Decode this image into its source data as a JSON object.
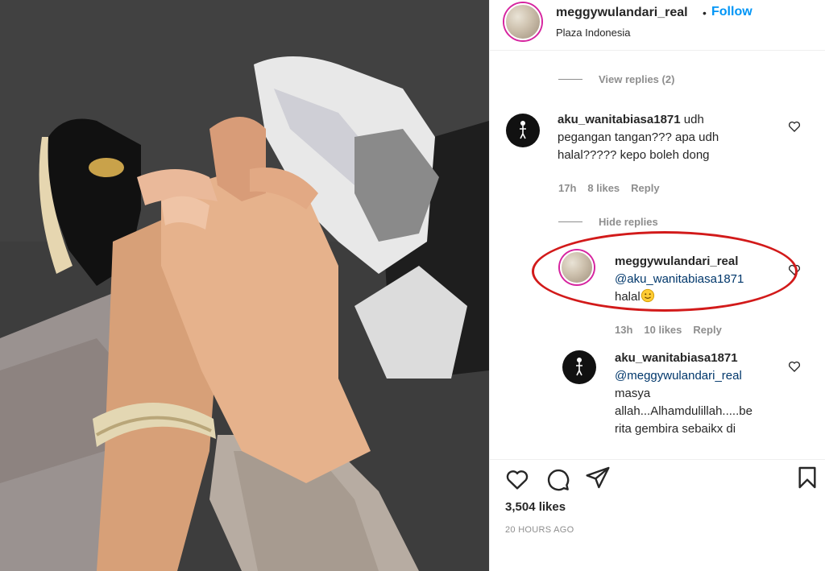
{
  "post": {
    "username": "meggywulandari_real",
    "follow_label": "Follow",
    "location": "Plaza Indonesia",
    "likes": "3,504 likes",
    "time_ago": "20 HOURS AGO"
  },
  "thread": {
    "view_replies": "View replies (2)",
    "hide_replies": "Hide replies",
    "comment1": {
      "username": "aku_wanitabiasa1871",
      "line1": "udh",
      "line2": "pegangan tangan??? apa udh",
      "line3": "halal????? kepo boleh dong",
      "time": "17h",
      "likes": "8 likes",
      "reply": "Reply"
    },
    "reply1": {
      "username": "meggywulandari_real",
      "mention": "@aku_wanitabiasa1871",
      "text": "halal",
      "time": "13h",
      "likes": "10 likes",
      "reply": "Reply"
    },
    "reply2": {
      "username": "aku_wanitabiasa1871",
      "mention": "@meggywulandari_real",
      "line1": "masya",
      "line2": "allah...Alhamdulillah.....be",
      "line3": "rita gembira sebaikx di"
    }
  },
  "icons": {
    "like": "heart-icon",
    "comment": "comment-bubble-icon",
    "share": "paper-plane-icon",
    "save": "bookmark-icon",
    "comment_like": "small-heart-icon",
    "emoji": "smiling-face-emoji"
  },
  "colors": {
    "follow_blue": "#0095f6",
    "mention_blue": "#00376b",
    "highlight_red": "#d21a1a",
    "muted_gray": "#8e8e8e"
  }
}
